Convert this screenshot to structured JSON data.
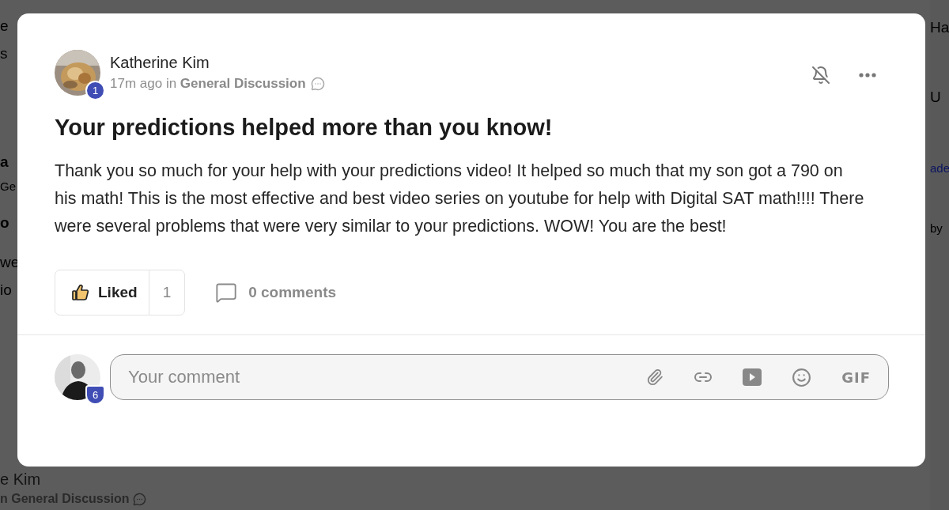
{
  "backdrop": {
    "left_fragments": [
      "e",
      "s",
      "a",
      "Ge",
      "o",
      "we",
      "io"
    ],
    "right_fragments": [
      {
        "text": "Ha",
        "kind": "heading"
      },
      {
        "text": "U",
        "kind": "heading"
      },
      {
        "text": "ade",
        "kind": "link"
      },
      {
        "text": "by",
        "kind": "meta"
      }
    ],
    "bottom_author": "e Kim",
    "bottom_meta": "n General Discussion"
  },
  "post": {
    "author": "Katherine Kim",
    "author_badge": "1",
    "meta": "17m ago in **General Discussion**",
    "title": "Your predictions helped more than you know!",
    "body": "Thank you so much for your help with your predictions video! It helped so much that my son got a 790 on his math! This is the most effective and best video series on youtube for help with Digital SAT math!!!! There were several problems that were very similar to your predictions. WOW! You are the best!",
    "like": {
      "label": "Liked",
      "count": "1",
      "liked": true
    },
    "comments": "0 comments"
  },
  "composer": {
    "user_badge": "6",
    "placeholder": "Your comment",
    "tools": [
      {
        "kind": "attach"
      },
      {
        "kind": "link"
      },
      {
        "kind": "video"
      },
      {
        "kind": "emoji"
      },
      {
        "kind": "gif",
        "label": "GIF"
      }
    ]
  }
}
